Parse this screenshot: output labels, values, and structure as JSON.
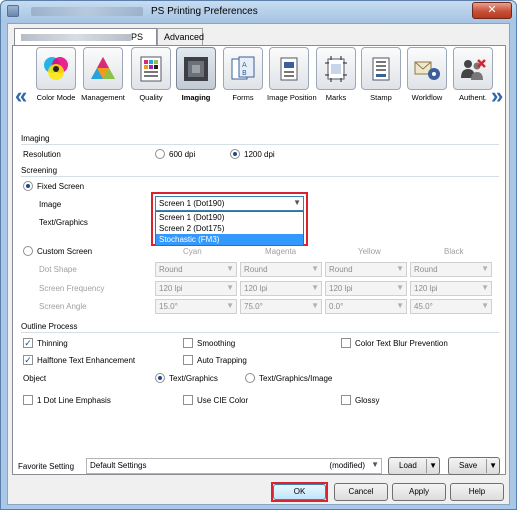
{
  "window": {
    "title": "PS Printing Preferences",
    "close_label": "✕"
  },
  "tabs": [
    {
      "label": "PS",
      "selected": true
    },
    {
      "label": "Advanced",
      "selected": false
    }
  ],
  "iconbar": {
    "items": [
      {
        "label": "Color Mode",
        "icon": "color-mode-icon"
      },
      {
        "label": "Management",
        "icon": "management-icon"
      },
      {
        "label": "Quality",
        "icon": "quality-icon"
      },
      {
        "label": "Imaging",
        "icon": "imaging-icon",
        "selected": true
      },
      {
        "label": "Forms",
        "icon": "forms-icon"
      },
      {
        "label": "Image Position",
        "icon": "image-position-icon"
      },
      {
        "label": "Marks",
        "icon": "marks-icon"
      },
      {
        "label": "Stamp",
        "icon": "stamp-icon"
      },
      {
        "label": "Workflow",
        "icon": "workflow-icon"
      },
      {
        "label": "Authent.",
        "icon": "authentication-icon"
      }
    ],
    "prev_arrow": "«",
    "next_arrow": "»"
  },
  "imaging": {
    "group_title": "Imaging",
    "resolution_label": "Resolution",
    "res_600": "600 dpi",
    "res_1200": "1200 dpi",
    "selected_resolution": "1200 dpi"
  },
  "screening": {
    "group_title": "Screening",
    "fixed_screen_label": "Fixed Screen",
    "image_label": "Image",
    "text_graphics_label": "Text/Graphics",
    "image_value": "Screen 1 (Dot190)",
    "dropdown_options": [
      "Screen 1 (Dot190)",
      "Screen 2 (Dot175)",
      "Stochastic (FM3)"
    ],
    "dropdown_selected": "Stochastic (FM3)",
    "custom_screen_label": "Custom Screen",
    "columns": [
      "Cyan",
      "Magenta",
      "Yellow",
      "Black"
    ],
    "dot_shape_label": "Dot Shape",
    "screen_frequency_label": "Screen Frequency",
    "screen_angle_label": "Screen Angle",
    "dot_shape": [
      "Round",
      "Round",
      "Round",
      "Round"
    ],
    "frequency": [
      "120 lpi",
      "120 lpi",
      "120 lpi",
      "120 lpi"
    ],
    "angle": [
      "15.0°",
      "75.0°",
      "0.0°",
      "45.0°"
    ]
  },
  "outline": {
    "group_title": "Outline Process",
    "thinning": "Thinning",
    "smoothing": "Smoothing",
    "color_text_blur": "Color Text Blur Prevention",
    "halftone": "Halftone Text Enhancement",
    "auto_trapping": "Auto Trapping"
  },
  "object": {
    "label": "Object",
    "text_graphics": "Text/Graphics",
    "text_graphics_image": "Text/Graphics/Image"
  },
  "misc": {
    "dot_line": "1 Dot Line Emphasis",
    "cie_color": "Use CIE Color",
    "glossy": "Glossy"
  },
  "favorite": {
    "label": "Favorite Setting",
    "value": "Default Settings",
    "modified": "(modified)",
    "load": "Load",
    "save": "Save"
  },
  "dialog_buttons": {
    "ok": "OK",
    "cancel": "Cancel",
    "apply": "Apply",
    "help": "Help"
  }
}
